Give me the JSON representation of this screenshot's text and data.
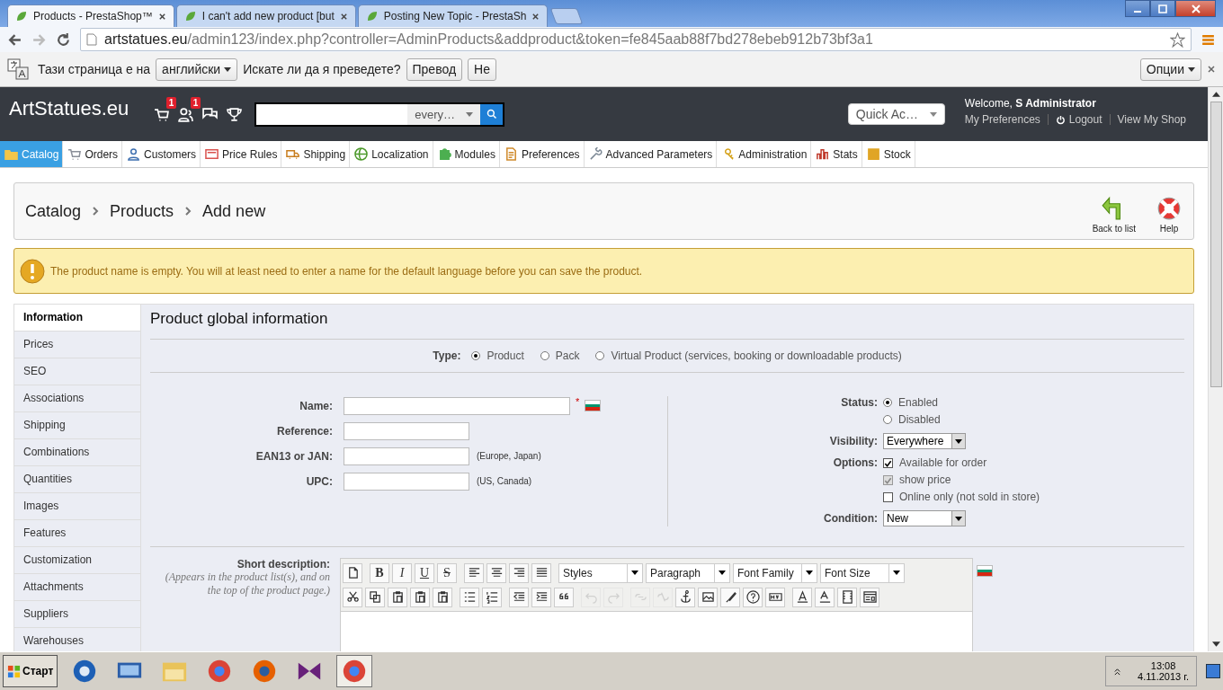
{
  "browser": {
    "tabs": [
      {
        "label": "Products - PrestaShop™",
        "selected": true
      },
      {
        "label": "I can't add new product [but",
        "selected": false
      },
      {
        "label": "Posting New Topic - PrestaSh",
        "selected": false
      }
    ],
    "url": {
      "host": "artstatues.eu",
      "path": "/admin123/index.php?controller=AdminProducts&addproduct&token=fe845aab88f7bd278ebeb912b73bf3a1"
    },
    "translate_bar": {
      "text_before": "Тази страница е на",
      "language": "английски",
      "text_after": "Искате ли да я преведете?",
      "translate_button": "Превод",
      "no_button": "Не",
      "options_button": "Опции"
    }
  },
  "header": {
    "logo": "ArtStatues.eu",
    "notifications": [
      {
        "kind": "cart",
        "count": "1"
      },
      {
        "kind": "customers",
        "count": "1"
      },
      {
        "kind": "messages"
      },
      {
        "kind": "trophy"
      }
    ],
    "search": {
      "filter": "every…"
    },
    "quick_access": "Quick Ac…",
    "welcome": {
      "prefix": "Welcome,",
      "name": "S Administrator"
    },
    "links": [
      {
        "kind": "preferences",
        "label": "My Preferences"
      },
      {
        "kind": "logout",
        "label": "Logout"
      },
      {
        "kind": "shop",
        "label": "View My Shop"
      }
    ]
  },
  "menu": [
    {
      "kind": "folder",
      "label": "Catalog",
      "selected": true
    },
    {
      "kind": "cart",
      "label": "Orders",
      "selected": false
    },
    {
      "kind": "person",
      "label": "Customers",
      "selected": false
    },
    {
      "kind": "tag",
      "label": "Price Rules",
      "selected": false
    },
    {
      "kind": "truck",
      "label": "Shipping",
      "selected": false
    },
    {
      "kind": "globe",
      "label": "Localization",
      "selected": false
    },
    {
      "kind": "puzzle",
      "label": "Modules",
      "selected": false
    },
    {
      "kind": "doc",
      "label": "Preferences",
      "selected": false
    },
    {
      "kind": "wrench",
      "label": "Advanced Parameters",
      "selected": false
    },
    {
      "kind": "key",
      "label": "Administration",
      "selected": false
    },
    {
      "kind": "chart",
      "label": "Stats",
      "selected": false
    },
    {
      "kind": "box",
      "label": "Stock",
      "selected": false
    }
  ],
  "breadcrumb": [
    "Catalog",
    "Products",
    "Add new"
  ],
  "toolbar": [
    {
      "kind": "back",
      "label": "Back to list"
    },
    {
      "kind": "help",
      "label": "Help"
    }
  ],
  "warning": "The product name is empty. You will at least need to enter a name for the default language before you can save the product.",
  "side_tabs": [
    {
      "label": "Information",
      "selected": true
    },
    {
      "label": "Prices",
      "selected": false
    },
    {
      "label": "SEO",
      "selected": false
    },
    {
      "label": "Associations",
      "selected": false
    },
    {
      "label": "Shipping",
      "selected": false
    },
    {
      "label": "Combinations",
      "selected": false
    },
    {
      "label": "Quantities",
      "selected": false
    },
    {
      "label": "Images",
      "selected": false
    },
    {
      "label": "Features",
      "selected": false
    },
    {
      "label": "Customization",
      "selected": false
    },
    {
      "label": "Attachments",
      "selected": false
    },
    {
      "label": "Suppliers",
      "selected": false
    },
    {
      "label": "Warehouses",
      "selected": false
    }
  ],
  "panel": {
    "title": "Product global information",
    "type": {
      "label": "Type:",
      "options": [
        {
          "label": "Product",
          "selected": true
        },
        {
          "label": "Pack",
          "selected": false
        },
        {
          "label": "Virtual Product (services, booking or downloadable products)",
          "selected": false
        }
      ]
    },
    "fields": [
      {
        "label": "Name:",
        "required_mark": "*",
        "wide": true
      },
      {
        "label": "Reference:",
        "wide": false
      },
      {
        "label": "EAN13 or JAN:",
        "wide": false,
        "hint": "(Europe, Japan)"
      },
      {
        "label": "UPC:",
        "wide": false,
        "hint": "(US, Canada)"
      }
    ],
    "status": {
      "label": "Status:",
      "options": [
        {
          "label": "Enabled",
          "selected": true
        },
        {
          "label": "Disabled",
          "selected": false
        }
      ]
    },
    "visibility": {
      "label": "Visibility:",
      "value": "Everywhere"
    },
    "options": {
      "label": "Options:",
      "items": [
        {
          "label": "Available for order",
          "checked": true,
          "disabled": false
        },
        {
          "label": "show price",
          "checked": true,
          "disabled": true
        },
        {
          "label": "Online only (not sold in store)",
          "checked": false,
          "disabled": false
        }
      ]
    },
    "condition": {
      "label": "Condition:",
      "value": "New"
    },
    "short_description": {
      "label": "Short description:",
      "hint": "(Appears in the product list(s), and on the top of the product page.)",
      "row1": [
        [
          {
            "kind": "new"
          }
        ],
        [
          {
            "kind": "bold",
            "label": "B"
          },
          {
            "kind": "italic",
            "label": "I"
          },
          {
            "kind": "underline",
            "label": "U"
          },
          {
            "kind": "strike",
            "label": "S"
          }
        ],
        [
          {
            "kind": "align-left"
          },
          {
            "kind": "align-center"
          },
          {
            "kind": "align-right"
          },
          {
            "kind": "justify"
          }
        ]
      ],
      "dropdowns": [
        "Styles",
        "Paragraph",
        "Font Family",
        "Font Size"
      ],
      "row2": [
        [
          {
            "kind": "cut",
            "disabled": false
          },
          {
            "kind": "copy",
            "disabled": false
          },
          {
            "kind": "paste",
            "disabled": false
          },
          {
            "kind": "paste",
            "disabled": false
          },
          {
            "kind": "paste",
            "disabled": false
          }
        ],
        [
          {
            "kind": "bullets",
            "disabled": false
          },
          {
            "kind": "numbers",
            "disabled": false
          }
        ],
        [
          {
            "kind": "outdent",
            "disabled": false
          },
          {
            "kind": "indent",
            "disabled": false
          },
          {
            "kind": "quote",
            "disabled": false
          }
        ],
        [
          {
            "kind": "undo",
            "disabled": true
          },
          {
            "kind": "redo",
            "disabled": true
          }
        ],
        [
          {
            "kind": "link",
            "disabled": true
          },
          {
            "kind": "unlink",
            "disabled": true
          },
          {
            "kind": "anchor",
            "disabled": false
          },
          {
            "kind": "image",
            "disabled": false
          },
          {
            "kind": "brush",
            "disabled": false
          },
          {
            "kind": "help",
            "disabled": false
          },
          {
            "kind": "html",
            "disabled": false
          }
        ],
        [
          {
            "kind": "text-color",
            "disabled": false
          },
          {
            "kind": "highlight",
            "disabled": false
          },
          {
            "kind": "media",
            "disabled": false
          },
          {
            "kind": "template",
            "disabled": false
          }
        ]
      ]
    }
  },
  "taskbar": {
    "start": "Старт",
    "apps": [
      {
        "kind": "globe",
        "selected": false
      },
      {
        "kind": "monitor",
        "selected": false
      },
      {
        "kind": "folder",
        "selected": false
      },
      {
        "kind": "chrome",
        "selected": false
      },
      {
        "kind": "firefox",
        "selected": false
      },
      {
        "kind": "bowtie",
        "selected": false
      },
      {
        "kind": "chrome",
        "selected": true
      }
    ],
    "time": "13:08",
    "date": "4.11.2013 г."
  }
}
